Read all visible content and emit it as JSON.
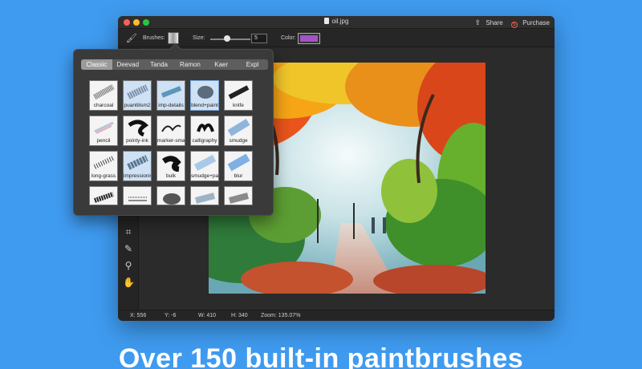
{
  "window": {
    "title": "oil.jpg",
    "share_label": "Share",
    "purchase_label": "Purchase"
  },
  "toolbar": {
    "brushes_label": "Brushes:",
    "size_label": "Size:",
    "size_value": "5",
    "color_label": "Color:",
    "color_value": "#a453c6"
  },
  "brush_popover": {
    "tabs": [
      "Classic",
      "Deevad",
      "Tanda",
      "Ramon",
      "Kaer",
      "Expl"
    ],
    "active_tab": "Classic",
    "brushes": [
      "charcoal",
      "puantilism2",
      "imp-details",
      "blend+paint",
      "knife",
      "pencil",
      "pointy-ink",
      "marker-small",
      "calligraphy",
      "smudge",
      "long-grass",
      "impressionism",
      "bulk",
      "smudge+paint",
      "blur",
      "",
      "",
      "",
      "",
      ""
    ]
  },
  "statusbar": {
    "x": "X:   556",
    "y": "Y:   -6",
    "w": "W:   410",
    "h": "H:   340",
    "zoom": "Zoom:   135.07%"
  },
  "headline": "Over 150 built-in paintbrushes",
  "colors": {
    "background": "#3f9bf0",
    "window": "#2a2a2a",
    "accent_purchase": "#ff5a4a"
  }
}
